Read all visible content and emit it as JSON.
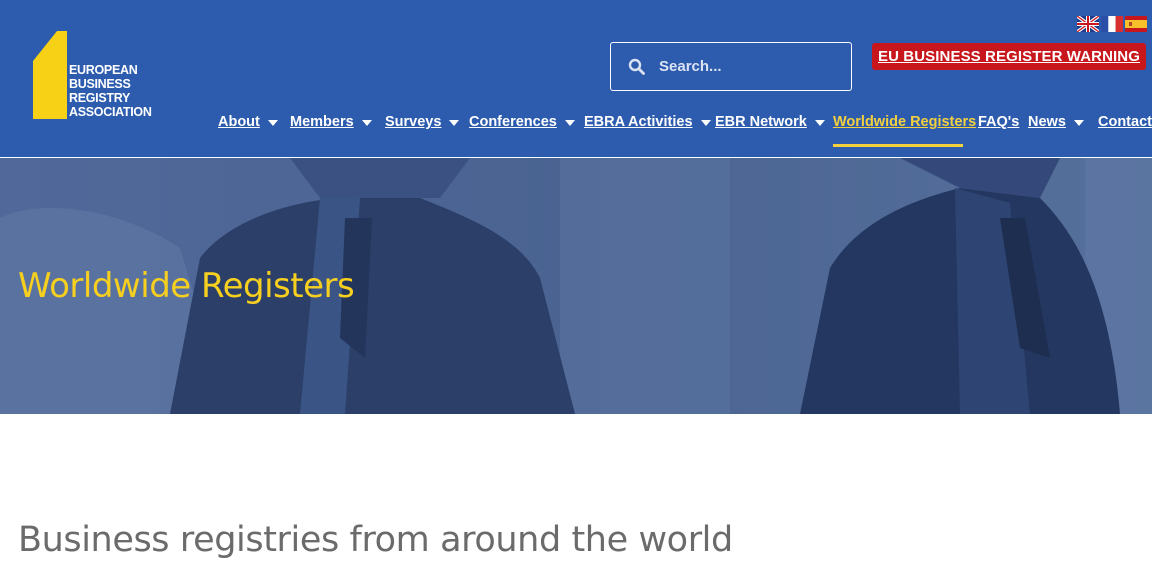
{
  "logo": {
    "lines": [
      "EUROPEAN",
      "BUSINESS",
      "REGISTRY",
      "ASSOCIATION"
    ]
  },
  "flags": [
    "uk-flag",
    "france-flag",
    "spain-flag"
  ],
  "search": {
    "placeholder": "Search..."
  },
  "warning": {
    "label": "EU BUSINESS REGISTER WARNING"
  },
  "nav": {
    "items": [
      {
        "label": "About",
        "dropdown": true
      },
      {
        "label": "Members",
        "dropdown": true
      },
      {
        "label": "Surveys",
        "dropdown": true
      },
      {
        "label": "Conferences",
        "dropdown": true
      },
      {
        "label": "EBRA Activities",
        "dropdown": true
      },
      {
        "label": "EBR Network",
        "dropdown": true
      },
      {
        "label": "Worldwide Registers",
        "dropdown": false,
        "active": true
      },
      {
        "label": "FAQ's",
        "dropdown": false
      },
      {
        "label": "News",
        "dropdown": true
      },
      {
        "label": "Contact",
        "dropdown": false
      }
    ]
  },
  "hero": {
    "title": "Worldwide Registers"
  },
  "content": {
    "heading": "Business registries from around the world"
  },
  "colors": {
    "header": "#2d5cae",
    "accent": "#f4d03f",
    "warning": "#c8161d"
  }
}
